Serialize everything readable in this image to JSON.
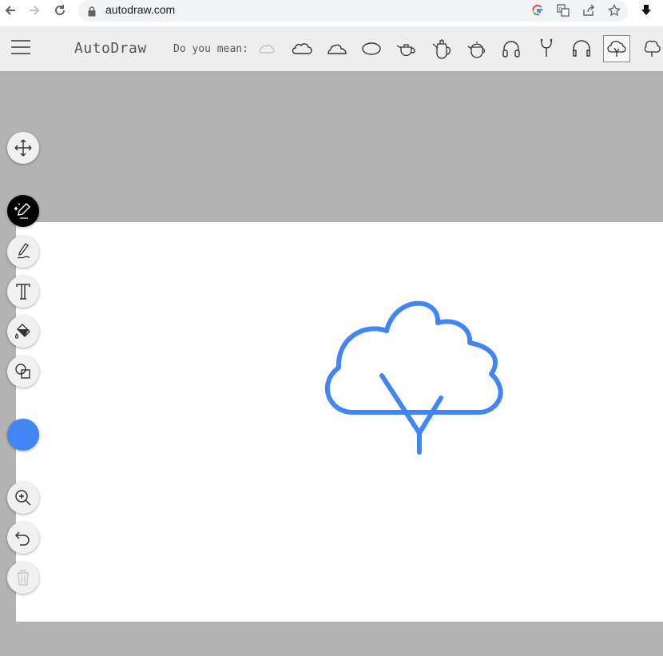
{
  "browser": {
    "url": "autodraw.com",
    "icons": [
      "back-arrow-icon",
      "forward-arrow-icon",
      "reload-icon",
      "lock-icon",
      "google-icon",
      "translate-icon",
      "share-icon",
      "star-icon",
      "extension-download-icon"
    ]
  },
  "app": {
    "brand": "AutoDraw",
    "suggest_label": "Do you mean:",
    "suggestions": [
      "cloud",
      "cloud",
      "cloud",
      "cloud",
      "teapot",
      "teapot",
      "teapot",
      "headphones",
      "stethoscope",
      "headphones",
      "tree",
      "tree"
    ],
    "selected_suggestion_index": 10
  },
  "toolbar": {
    "tools": [
      "select",
      "autodraw",
      "draw",
      "type",
      "fill",
      "shape",
      "color",
      "zoom",
      "undo",
      "delete"
    ],
    "active_tool": "autodraw",
    "current_color": "#4285f4"
  },
  "drawing": {
    "subject": "tree",
    "stroke_color": "#4285f4"
  }
}
